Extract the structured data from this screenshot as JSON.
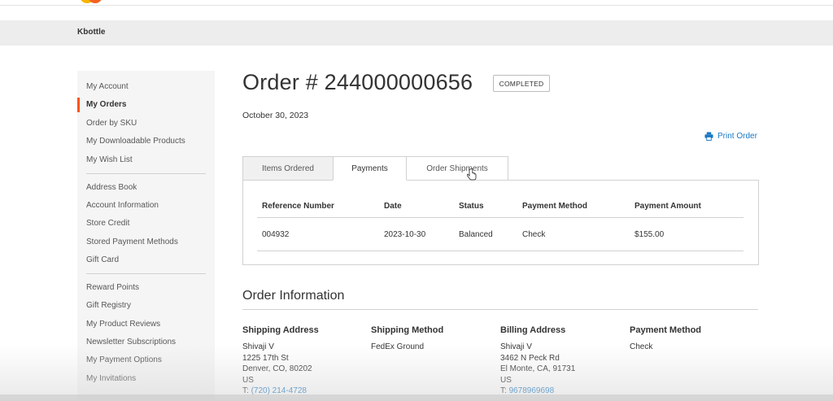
{
  "store": {
    "name": "Kbottle"
  },
  "sidebar": {
    "items": [
      {
        "label": "My Account",
        "active": false
      },
      {
        "label": "My Orders",
        "active": true
      },
      {
        "label": "Order by SKU",
        "active": false
      },
      {
        "label": "My Downloadable Products",
        "active": false
      },
      {
        "label": "My Wish List",
        "active": false
      },
      {
        "label": "Address Book",
        "active": false
      },
      {
        "label": "Account Information",
        "active": false
      },
      {
        "label": "Store Credit",
        "active": false
      },
      {
        "label": "Stored Payment Methods",
        "active": false
      },
      {
        "label": "Gift Card",
        "active": false
      },
      {
        "label": "Reward Points",
        "active": false
      },
      {
        "label": "Gift Registry",
        "active": false
      },
      {
        "label": "My Product Reviews",
        "active": false
      },
      {
        "label": "Newsletter Subscriptions",
        "active": false
      },
      {
        "label": "My Payment Options",
        "active": false
      },
      {
        "label": "My Invitations",
        "active": false
      }
    ]
  },
  "order": {
    "title": "Order # 244000000656",
    "status": "COMPLETED",
    "date": "October 30, 2023",
    "print_label": "Print Order"
  },
  "tabs": [
    {
      "label": "Items Ordered"
    },
    {
      "label": "Payments"
    },
    {
      "label": "Order Shipments"
    }
  ],
  "payments_table": {
    "headers": [
      "Reference Number",
      "Date",
      "Status",
      "Payment Method",
      "Payment Amount"
    ],
    "rows": [
      [
        "004932",
        "2023-10-30",
        "Balanced",
        "Check",
        "$155.00"
      ]
    ]
  },
  "order_info": {
    "title": "Order Information",
    "shipping_address": {
      "title": "Shipping Address",
      "lines": [
        "Shivaji V",
        "1225 17th St",
        "Denver, CO, 80202",
        "US"
      ],
      "phone_prefix": "T: ",
      "phone": "(720) 214-4728"
    },
    "shipping_method": {
      "title": "Shipping Method",
      "value": "FedEx Ground"
    },
    "billing_address": {
      "title": "Billing Address",
      "lines": [
        "Shivaji V",
        "3462 N Peck Rd",
        "El Monte, CA, 91731",
        "US"
      ],
      "phone_prefix": "T: ",
      "phone": "9678969698"
    },
    "payment_method": {
      "title": "Payment Method",
      "value": "Check"
    }
  },
  "colors": {
    "accent": "#ff5501",
    "link": "#1979c3",
    "badge_border": "#bbbbbb",
    "breadcrumb_bg": "#ededed",
    "sidebar_bg": "#f5f5f5"
  },
  "icons": {
    "print": "printer-icon",
    "logo": "magento-logo",
    "cursor": "pointer-cursor"
  }
}
